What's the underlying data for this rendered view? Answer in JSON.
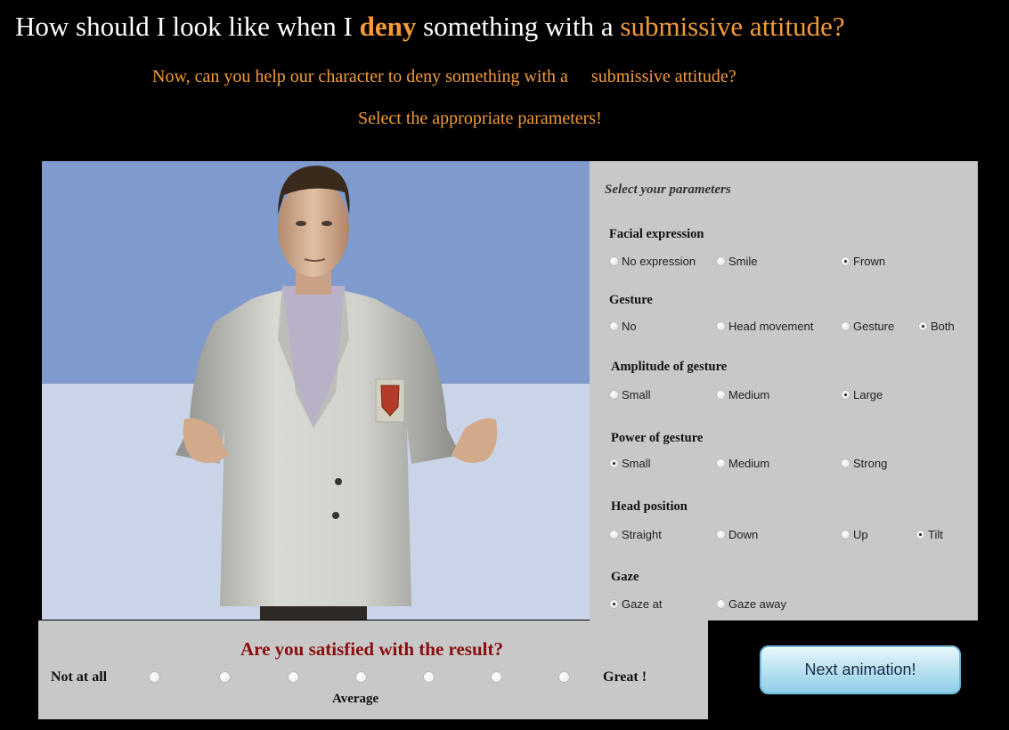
{
  "header": {
    "title_part1": "How should I look like when I ",
    "title_emph": "deny",
    "title_part2": " something with a ",
    "title_attitude": "submissive attitude?",
    "subtitle_part1": "Now, can you help our character to deny something with a",
    "subtitle_part2": "submissive attitude?",
    "instruction": "Select the appropriate parameters!"
  },
  "params": {
    "title": "Select your parameters",
    "groups": [
      {
        "name": "Facial expression",
        "options": [
          "No expression",
          "Smile",
          "Frown"
        ],
        "selected": "Frown"
      },
      {
        "name": "Gesture",
        "options": [
          "No",
          "Head movement",
          "Gesture",
          "Both"
        ],
        "selected": "Both"
      },
      {
        "name": "Amplitude of gesture",
        "options": [
          "Small",
          "Medium",
          "Large"
        ],
        "selected": "Large"
      },
      {
        "name": "Power of gesture",
        "options": [
          "Small",
          "Medium",
          "Strong"
        ],
        "selected": "Small"
      },
      {
        "name": "Head position",
        "options": [
          "Straight",
          "Down",
          "Up",
          "Tilt"
        ],
        "selected": "Tilt"
      },
      {
        "name": "Gaze",
        "options": [
          "Gaze at",
          "Gaze away"
        ],
        "selected": "Gaze at"
      }
    ]
  },
  "satisfaction": {
    "question": "Are you satisfied with the result?",
    "low_label": "Not at all",
    "mid_label": "Average",
    "high_label": "Great !",
    "scale_points": 7
  },
  "next_button": {
    "label": "Next animation!"
  },
  "colors": {
    "accent": "#f29b38",
    "question": "#8b0d0d",
    "panel": "#c8c8c8",
    "sky": "#7f9acc",
    "floor": "#c9d4e8"
  }
}
